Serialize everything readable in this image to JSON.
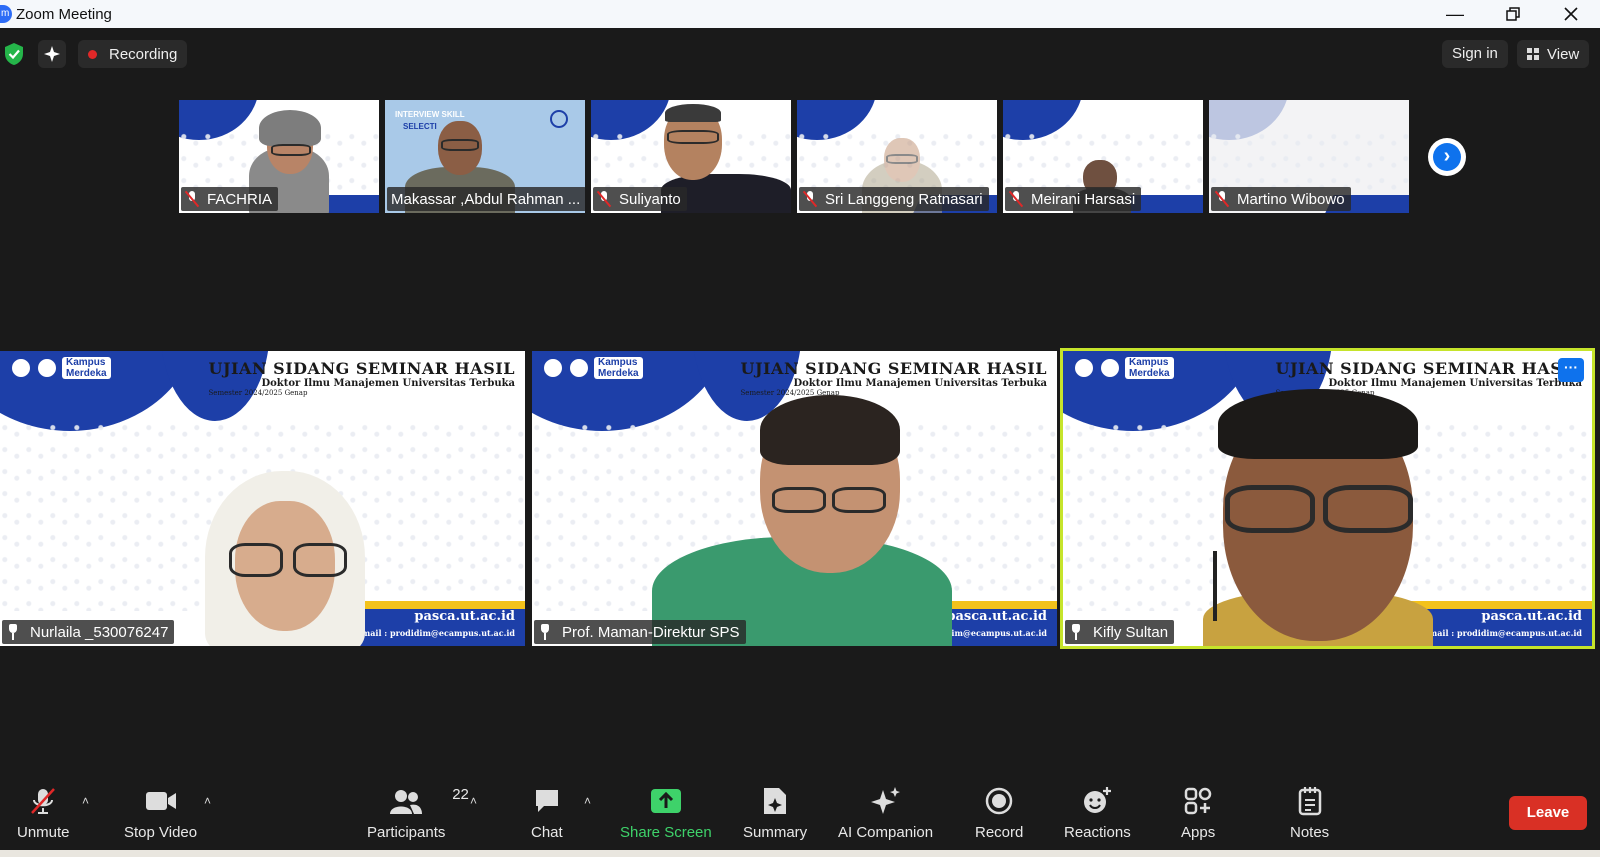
{
  "window": {
    "title": "Zoom Meeting",
    "app_icon": "m"
  },
  "topbar": {
    "recording_label": "Recording",
    "sign_in_label": "Sign in",
    "view_label": "View"
  },
  "thumbnails": [
    {
      "name": "FACHRIA",
      "muted": true
    },
    {
      "name": "Makassar ,Abdul Rahman ...",
      "muted": false,
      "slide_text": "INTERVIEW SKILL",
      "slide_sub": "SELECTI"
    },
    {
      "name": "Suliyanto",
      "muted": true
    },
    {
      "name": "Sri Langgeng Ratnasari",
      "muted": true
    },
    {
      "name": "Meirani Harsasi",
      "muted": true
    },
    {
      "name": "Martino Wibowo",
      "muted": true
    }
  ],
  "slide": {
    "title": "UJIAN SIDANG SEMINAR HASIL",
    "subtitle": "Doktor Ilmu Manajemen Universitas Terbuka",
    "semester": "Semester 2024/2025 Genap",
    "site": "pasca.ut.ac.id",
    "email": "Email : prodidim@ecampus.ut.ac.id",
    "logo_text_1": "Kampus",
    "logo_text_2": "Merdeka",
    "thumb_site": "pasca.ut.ac.id"
  },
  "tiles": [
    {
      "name": "Nurlaila _530076247",
      "active": false
    },
    {
      "name": "Prof. Maman-Direktur SPS",
      "active": false
    },
    {
      "name": "Kifly Sultan",
      "active": true
    }
  ],
  "toolbar": {
    "unmute": "Unmute",
    "stop_video": "Stop Video",
    "participants": "Participants",
    "participant_count": "22",
    "chat": "Chat",
    "share_screen": "Share Screen",
    "summary": "Summary",
    "ai_companion": "AI Companion",
    "record": "Record",
    "reactions": "Reactions",
    "apps": "Apps",
    "notes": "Notes",
    "leave": "Leave"
  },
  "colors": {
    "accent_blue": "#0e72ed",
    "active_speaker": "#c6e42b",
    "leave_red": "#d93025",
    "share_green": "#3ed26a"
  }
}
